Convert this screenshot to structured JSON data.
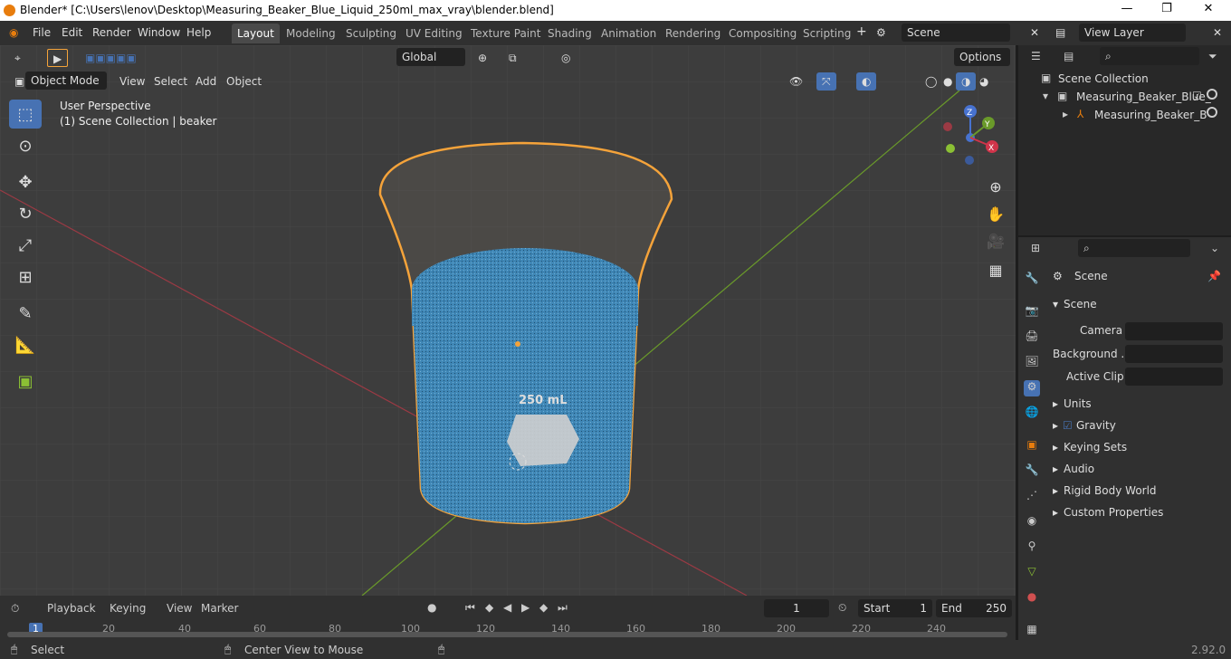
{
  "window": {
    "title": "Blender* [C:\\Users\\lenov\\Desktop\\Measuring_Beaker_Blue_Liquid_250ml_max_vray\\blender.blend]",
    "minimize": "—",
    "maximize": "❐",
    "close": "✕"
  },
  "menu": [
    "File",
    "Edit",
    "Render",
    "Window",
    "Help"
  ],
  "workspaces": [
    "Layout",
    "Modeling",
    "Sculpting",
    "UV Editing",
    "Texture Paint",
    "Shading",
    "Animation",
    "Rendering",
    "Compositing",
    "Scripting"
  ],
  "scene_field": "Scene",
  "view_layer_field": "View Layer",
  "viewport": {
    "mode": "Object Mode",
    "menus": [
      "View",
      "Select",
      "Add",
      "Object"
    ],
    "transform": "Global",
    "options": "Options",
    "overlay_line1": "User Perspective",
    "overlay_line2": "(1) Scene Collection | beaker",
    "label_text": "250 mL",
    "axis_x": "X",
    "axis_y": "Y",
    "axis_z": "Z"
  },
  "outliner": {
    "root": "Scene Collection",
    "item1": "Measuring_Beaker_Blue_",
    "item2": "Measuring_Beaker_B"
  },
  "properties": {
    "header": "Scene",
    "panel": "Scene",
    "camera_label": "Camera",
    "background_label": "Background ...",
    "active_clip_label": "Active Clip",
    "sections": [
      "Units",
      "Gravity",
      "Keying Sets",
      "Audio",
      "Rigid Body World",
      "Custom Properties"
    ]
  },
  "timeline": {
    "menus": [
      "Playback",
      "Keying",
      "View",
      "Marker"
    ],
    "current_frame": "1",
    "start_label": "Start",
    "start_value": "1",
    "end_label": "End",
    "end_value": "250",
    "ticks": [
      "1",
      "20",
      "40",
      "60",
      "80",
      "100",
      "120",
      "140",
      "160",
      "180",
      "200",
      "220",
      "240"
    ]
  },
  "status": {
    "select": "Select",
    "center": "Center View to Mouse",
    "version": "2.92.0"
  },
  "colors": {
    "accent": "#4772b3",
    "selection_outline": "#f5a33a",
    "liquid": "#3f86b5"
  }
}
